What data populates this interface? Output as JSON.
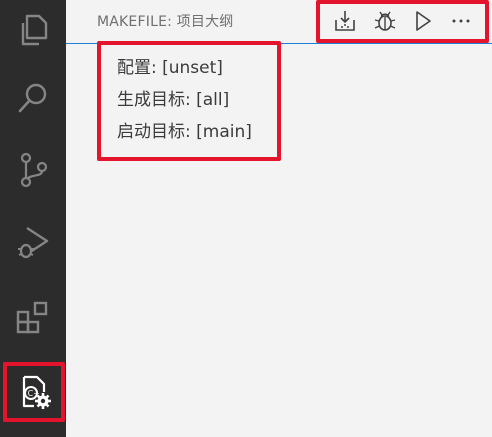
{
  "activity_bar": {
    "items": [
      {
        "name": "explorer-icon"
      },
      {
        "name": "search-icon"
      },
      {
        "name": "source-control-icon"
      },
      {
        "name": "run-debug-icon"
      },
      {
        "name": "extensions-icon"
      },
      {
        "name": "makefile-tools-icon",
        "active": true
      }
    ]
  },
  "panel": {
    "title": "MAKEFILE: 项目大纲",
    "toolbar": [
      {
        "name": "build-icon"
      },
      {
        "name": "debug-icon"
      },
      {
        "name": "run-icon"
      },
      {
        "name": "more-actions-icon"
      }
    ]
  },
  "outline": {
    "configuration": "配置: [unset]",
    "build_target": "生成目标: [all]",
    "launch_target": "启动目标: [main]"
  },
  "colors": {
    "activity_bar_bg": "#2c2c2c",
    "panel_bg": "#f3f3f3",
    "highlight": "#e3142b",
    "focus_border": "#1f7fd4"
  }
}
